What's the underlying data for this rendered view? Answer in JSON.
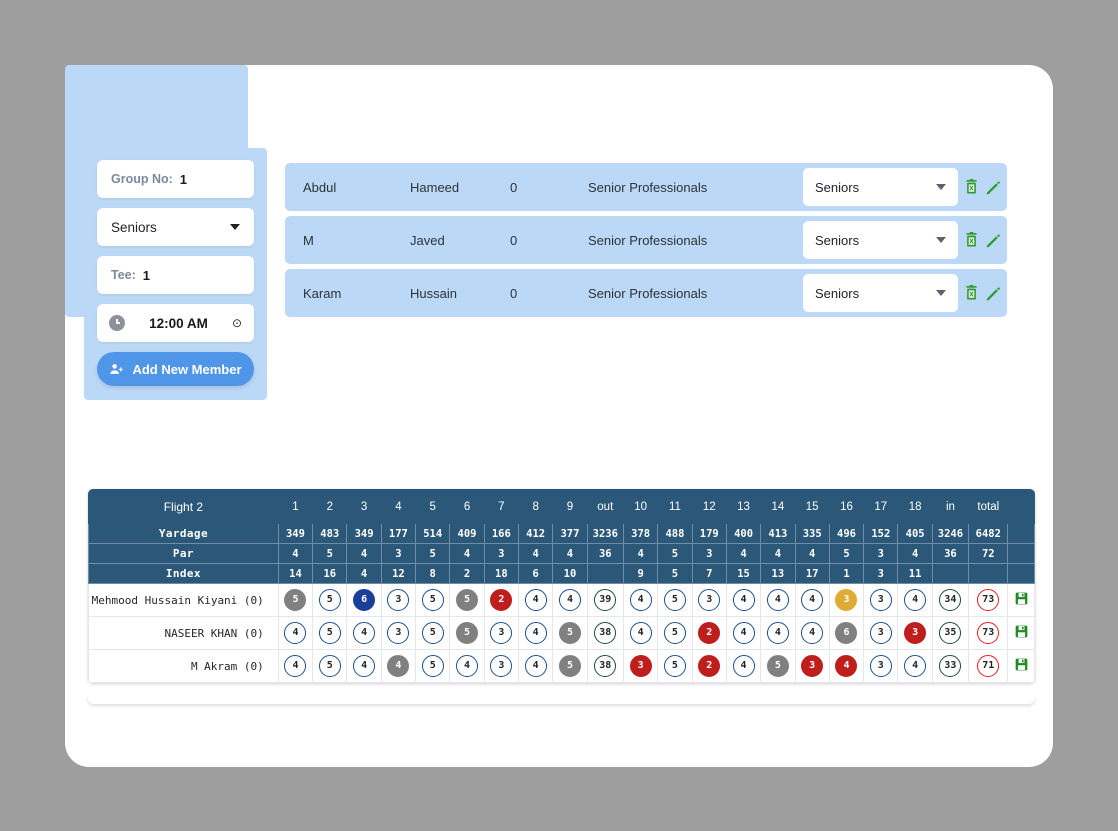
{
  "left_panel": {
    "group": {
      "label": "Group No:",
      "value": "1"
    },
    "category_select": {
      "value": "Seniors"
    },
    "tee": {
      "label": "Tee:",
      "value": "1"
    },
    "time": {
      "value": "12:00 AM",
      "suffix": "⊙"
    },
    "add_button": {
      "label": "Add New Member"
    }
  },
  "members": {
    "columns": [
      "first_name",
      "last_name",
      "handicap",
      "category",
      "group"
    ],
    "rows": [
      {
        "first_name": "Abdul",
        "last_name": "Hameed",
        "handicap": "0",
        "category": "Senior Professionals",
        "group": "Seniors"
      },
      {
        "first_name": "M",
        "last_name": "Javed",
        "handicap": "0",
        "category": "Senior Professionals",
        "group": "Seniors"
      },
      {
        "first_name": "Karam",
        "last_name": "Hussain",
        "handicap": "0",
        "category": "Senior Professionals",
        "group": "Seniors"
      }
    ],
    "actions": {
      "delete_label": "delete",
      "edit_label": "edit"
    }
  },
  "scorecard": {
    "title": "Flight 2",
    "hole_headers": [
      "1",
      "2",
      "3",
      "4",
      "5",
      "6",
      "7",
      "8",
      "9",
      "out",
      "10",
      "11",
      "12",
      "13",
      "14",
      "15",
      "16",
      "17",
      "18",
      "in",
      "total"
    ],
    "info_rows": [
      {
        "label": "Yardage",
        "values": [
          "349",
          "483",
          "349",
          "177",
          "514",
          "409",
          "166",
          "412",
          "377",
          "3236",
          "378",
          "488",
          "179",
          "400",
          "413",
          "335",
          "496",
          "152",
          "405",
          "3246",
          "6482"
        ]
      },
      {
        "label": "Par",
        "values": [
          "4",
          "5",
          "4",
          "3",
          "5",
          "4",
          "3",
          "4",
          "4",
          "36",
          "4",
          "5",
          "3",
          "4",
          "4",
          "4",
          "5",
          "3",
          "4",
          "36",
          "72"
        ]
      },
      {
        "label": "Index",
        "values": [
          "14",
          "16",
          "4",
          "12",
          "8",
          "2",
          "18",
          "6",
          "10",
          "",
          "9",
          "5",
          "7",
          "15",
          "13",
          "17",
          "1",
          "3",
          "11",
          "",
          ""
        ]
      }
    ],
    "players": [
      {
        "name": "Mehmood Hussain Kiyani (0)",
        "scores": [
          {
            "v": "5",
            "t": "bogey"
          },
          {
            "v": "5",
            "t": "par"
          },
          {
            "v": "6",
            "t": "dbogey"
          },
          {
            "v": "3",
            "t": "par"
          },
          {
            "v": "5",
            "t": "par"
          },
          {
            "v": "5",
            "t": "bogey"
          },
          {
            "v": "2",
            "t": "birdie"
          },
          {
            "v": "4",
            "t": "par"
          },
          {
            "v": "4",
            "t": "par"
          },
          {
            "v": "39",
            "t": "subtotal"
          },
          {
            "v": "4",
            "t": "par"
          },
          {
            "v": "5",
            "t": "par"
          },
          {
            "v": "3",
            "t": "par"
          },
          {
            "v": "4",
            "t": "par"
          },
          {
            "v": "4",
            "t": "par"
          },
          {
            "v": "4",
            "t": "par"
          },
          {
            "v": "3",
            "t": "eagle"
          },
          {
            "v": "3",
            "t": "par"
          },
          {
            "v": "4",
            "t": "par"
          },
          {
            "v": "34",
            "t": "subtotal"
          },
          {
            "v": "73",
            "t": "total"
          }
        ]
      },
      {
        "name": "NASEER KHAN (0)",
        "scores": [
          {
            "v": "4",
            "t": "par"
          },
          {
            "v": "5",
            "t": "par"
          },
          {
            "v": "4",
            "t": "par"
          },
          {
            "v": "3",
            "t": "par"
          },
          {
            "v": "5",
            "t": "par"
          },
          {
            "v": "5",
            "t": "bogey"
          },
          {
            "v": "3",
            "t": "par"
          },
          {
            "v": "4",
            "t": "par"
          },
          {
            "v": "5",
            "t": "bogey"
          },
          {
            "v": "38",
            "t": "subtotal"
          },
          {
            "v": "4",
            "t": "par"
          },
          {
            "v": "5",
            "t": "par"
          },
          {
            "v": "2",
            "t": "birdie"
          },
          {
            "v": "4",
            "t": "par"
          },
          {
            "v": "4",
            "t": "par"
          },
          {
            "v": "4",
            "t": "par"
          },
          {
            "v": "6",
            "t": "bogey"
          },
          {
            "v": "3",
            "t": "par"
          },
          {
            "v": "3",
            "t": "birdie"
          },
          {
            "v": "35",
            "t": "subtotal"
          },
          {
            "v": "73",
            "t": "total"
          }
        ]
      },
      {
        "name": "M Akram (0)",
        "scores": [
          {
            "v": "4",
            "t": "par"
          },
          {
            "v": "5",
            "t": "par"
          },
          {
            "v": "4",
            "t": "par"
          },
          {
            "v": "4",
            "t": "bogey"
          },
          {
            "v": "5",
            "t": "par"
          },
          {
            "v": "4",
            "t": "par"
          },
          {
            "v": "3",
            "t": "par"
          },
          {
            "v": "4",
            "t": "par"
          },
          {
            "v": "5",
            "t": "bogey"
          },
          {
            "v": "38",
            "t": "subtotal"
          },
          {
            "v": "3",
            "t": "birdie"
          },
          {
            "v": "5",
            "t": "par"
          },
          {
            "v": "2",
            "t": "birdie"
          },
          {
            "v": "4",
            "t": "par"
          },
          {
            "v": "5",
            "t": "bogey"
          },
          {
            "v": "3",
            "t": "birdie"
          },
          {
            "v": "4",
            "t": "birdie"
          },
          {
            "v": "3",
            "t": "par"
          },
          {
            "v": "4",
            "t": "par"
          },
          {
            "v": "33",
            "t": "subtotal"
          },
          {
            "v": "71",
            "t": "total"
          }
        ]
      }
    ],
    "save_label": "save"
  },
  "colors": {
    "page_background": "#9e9e9e",
    "panel_blue": "#bcd8f7",
    "header_steel": "#2b5778",
    "accent_button": "#4f96e8",
    "par_outline": "#1c4f91",
    "bogey_fill": "#808080",
    "double_bogey_fill": "#1a3f9b",
    "birdie_fill": "#be1f1c",
    "eagle_fill": "#dfab33",
    "subtotal_outline": "#1a5030",
    "total_outline": "#ee1b1b",
    "action_green": "#2e9b2e"
  }
}
